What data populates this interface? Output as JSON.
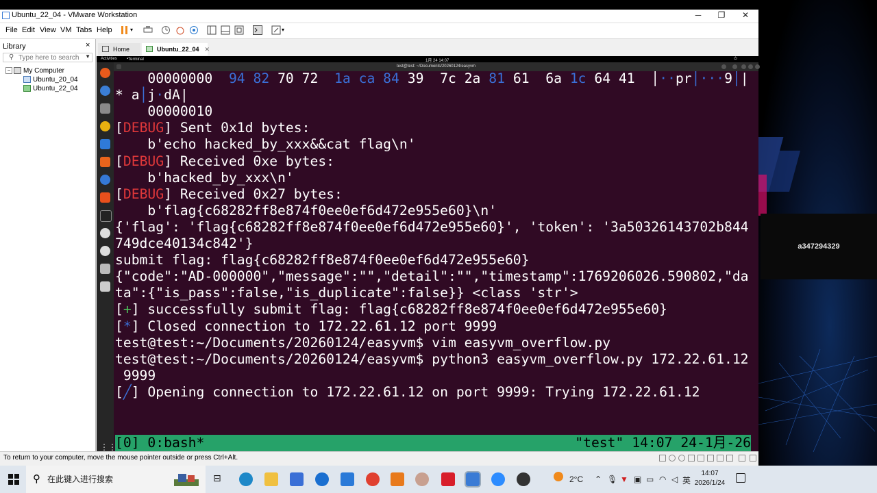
{
  "window": {
    "title": "Ubuntu_22_04 - VMware Workstation",
    "minimize": "─",
    "maximize": "❐",
    "close": "✕"
  },
  "menu": [
    "File",
    "Edit",
    "View",
    "VM",
    "Tabs",
    "Help"
  ],
  "library": {
    "title": "Library",
    "close": "×",
    "search_placeholder": "Type here to search",
    "root": "My Computer",
    "vms": [
      "Ubuntu_20_04",
      "Ubuntu_22_04"
    ]
  },
  "tabs": [
    {
      "label": "Home"
    },
    {
      "label": "Ubuntu_22_04",
      "active": true
    }
  ],
  "guest": {
    "activities": "Activities",
    "app": "Terminal",
    "clock": "1月 24 14:07",
    "terminal_title": "test@test: ~/Documents/20260124/easyvm"
  },
  "terminal": {
    "lines": [
      {
        "segments": [
          {
            "t": "    00000000  "
          },
          {
            "t": "94 82",
            "c": "dim"
          },
          {
            "t": " 70 72  "
          },
          {
            "t": "1a ca 84",
            "c": "dim"
          },
          {
            "t": " 39  7c 2a "
          },
          {
            "t": "81",
            "c": "dim"
          },
          {
            "t": " 61  6a "
          },
          {
            "t": "1c",
            "c": "dim"
          },
          {
            "t": " 64 41  │"
          },
          {
            "t": "··",
            "c": "dim"
          },
          {
            "t": "pr"
          },
          {
            "t": "│···",
            "c": "dim"
          },
          {
            "t": "9"
          },
          {
            "t": "│",
            "c": "dim"
          },
          {
            "t": "|"
          }
        ]
      },
      {
        "segments": [
          {
            "t": "* a"
          },
          {
            "t": "│",
            "c": "dim"
          },
          {
            "t": "j"
          },
          {
            "t": "·",
            "c": "dim"
          },
          {
            "t": "dA|"
          }
        ]
      },
      {
        "segments": [
          {
            "t": "    00000010"
          }
        ]
      },
      {
        "segments": [
          {
            "t": "["
          },
          {
            "t": "DEBUG",
            "c": "dbg"
          },
          {
            "t": "] Sent 0x1d bytes:"
          }
        ]
      },
      {
        "segments": [
          {
            "t": "    b'echo hacked_by_xxx&&cat flag\\n'"
          }
        ]
      },
      {
        "segments": [
          {
            "t": "["
          },
          {
            "t": "DEBUG",
            "c": "dbg"
          },
          {
            "t": "] Received 0xe bytes:"
          }
        ]
      },
      {
        "segments": [
          {
            "t": "    b'hacked_by_xxx\\n'"
          }
        ]
      },
      {
        "segments": [
          {
            "t": "["
          },
          {
            "t": "DEBUG",
            "c": "dbg"
          },
          {
            "t": "] Received 0x27 bytes:"
          }
        ]
      },
      {
        "segments": [
          {
            "t": "    b'flag{c68282ff8e874f0ee0ef6d472e955e60}\\n'"
          }
        ]
      },
      {
        "segments": [
          {
            "t": "{'flag': 'flag{c68282ff8e874f0ee0ef6d472e955e60}', 'token': '3a50326143702b844"
          }
        ]
      },
      {
        "segments": [
          {
            "t": "749dce40134c842'}"
          }
        ]
      },
      {
        "segments": [
          {
            "t": "submit flag: flag{c68282ff8e874f0ee0ef6d472e955e60}"
          }
        ]
      },
      {
        "segments": [
          {
            "t": "{\"code\":\"AD-000000\",\"message\":\"\",\"detail\":\"\",\"timestamp\":1769206026.590802,\"da"
          }
        ]
      },
      {
        "segments": [
          {
            "t": "ta\":{\"is_pass\":false,\"is_duplicate\":false}} <class 'str'>"
          }
        ]
      },
      {
        "segments": [
          {
            "t": "["
          },
          {
            "t": "+",
            "c": "plus"
          },
          {
            "t": "] successfully submit flag: flag{c68282ff8e874f0ee0ef6d472e955e60}"
          }
        ]
      },
      {
        "segments": [
          {
            "t": "["
          },
          {
            "t": "*",
            "c": "star"
          },
          {
            "t": "] Closed connection to 172.22.61.12 port 9999"
          }
        ]
      },
      {
        "segments": [
          {
            "t": "test@test:~/Documents/20260124/easyvm$ vim easyvm_overflow.py"
          }
        ]
      },
      {
        "segments": [
          {
            "t": "test@test:~/Documents/20260124/easyvm$ python3 easyvm_overflow.py 172.22.61.12"
          }
        ]
      },
      {
        "segments": [
          {
            "t": " 9999"
          }
        ]
      },
      {
        "segments": [
          {
            "t": "["
          },
          {
            "t": "╱",
            "c": "star"
          },
          {
            "t": "] Opening connection to 172.22.61.12 on port 9999: Trying 172.22.61.12"
          }
        ]
      }
    ],
    "tmux_left": "[0] 0:bash*",
    "tmux_right": "\"test\" 14:07 24-1月-26"
  },
  "statusbar": {
    "text": "To return to your computer, move the mouse pointer outside or press Ctrl+Alt."
  },
  "side_label": "a347294329",
  "taskbar": {
    "search_placeholder": "在此键入进行搜索",
    "weather": "2°C",
    "ime": "英",
    "time": "14:07",
    "date": "2026/1/24"
  }
}
